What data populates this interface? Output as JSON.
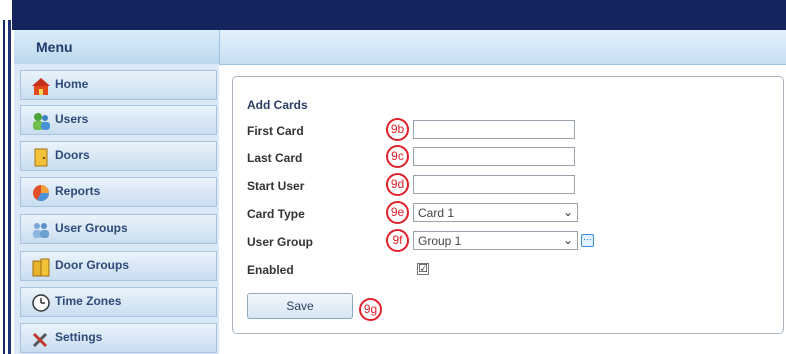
{
  "menu": {
    "header": "Menu",
    "items": [
      {
        "label": "Home",
        "icon": "home-icon"
      },
      {
        "label": "Users",
        "icon": "users-icon"
      },
      {
        "label": "Doors",
        "icon": "door-icon"
      },
      {
        "label": "Reports",
        "icon": "reports-icon"
      },
      {
        "label": "User Groups",
        "icon": "user-groups-icon"
      },
      {
        "label": "Door Groups",
        "icon": "door-groups-icon"
      },
      {
        "label": "Time Zones",
        "icon": "clock-icon"
      },
      {
        "label": "Settings",
        "icon": "settings-icon"
      }
    ]
  },
  "form": {
    "title": "Add Cards",
    "first_card": {
      "label": "First Card",
      "value": "",
      "callout": "9b"
    },
    "last_card": {
      "label": "Last Card",
      "value": "",
      "callout": "9c"
    },
    "start_user": {
      "label": "Start User",
      "value": "",
      "callout": "9d"
    },
    "card_type": {
      "label": "Card Type",
      "value": "Card 1",
      "callout": "9e"
    },
    "user_group": {
      "label": "User Group",
      "value": "Group 1",
      "callout": "9f"
    },
    "enabled": {
      "label": "Enabled",
      "checked": true,
      "mark": "☑"
    },
    "save": {
      "label": "Save",
      "callout": "9g"
    }
  },
  "colors": {
    "topbar": "#14255e",
    "callout": "#e0202a"
  }
}
